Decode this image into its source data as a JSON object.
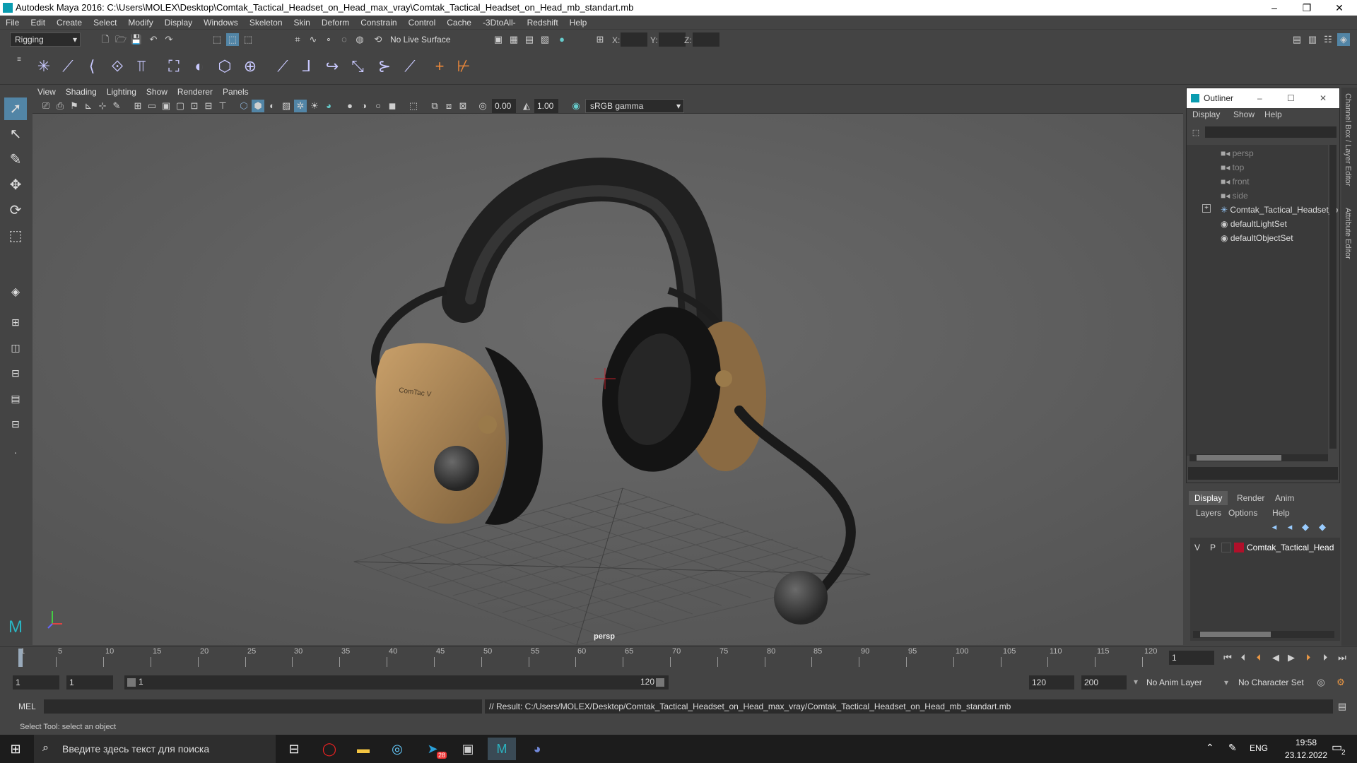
{
  "window": {
    "title": "Autodesk Maya 2016: C:\\Users\\MOLEX\\Desktop\\Comtak_Tactical_Headset_on_Head_max_vray\\Comtak_Tactical_Headset_on_Head_mb_standart.mb",
    "minimize": "–",
    "restore": "❐",
    "close": "✕"
  },
  "menubar": [
    "File",
    "Edit",
    "Create",
    "Select",
    "Modify",
    "Display",
    "Windows",
    "Skeleton",
    "Skin",
    "Deform",
    "Constrain",
    "Control",
    "Cache",
    "-3DtoAll-",
    "Redshift",
    "Help"
  ],
  "statusline": {
    "mode": "Rigging",
    "live_surface": "No Live Surface",
    "x_label": "X:",
    "y_label": "Y:",
    "z_label": "Z:"
  },
  "panel_menu": [
    "View",
    "Shading",
    "Lighting",
    "Show",
    "Renderer",
    "Panels"
  ],
  "panel_toolbar": {
    "value1": "0.00",
    "value2": "1.00",
    "color_space": "sRGB gamma"
  },
  "viewport": {
    "camera_label": "persp",
    "ear_logo": "ComTac V"
  },
  "outliner": {
    "title": "Outliner",
    "menu": [
      "Display",
      "Show",
      "Help"
    ],
    "items": [
      {
        "label": "persp",
        "dim": true
      },
      {
        "label": "top",
        "dim": true
      },
      {
        "label": "front",
        "dim": true
      },
      {
        "label": "side",
        "dim": true
      },
      {
        "label": "Comtak_Tactical_Headset_o",
        "dim": false
      },
      {
        "label": "defaultLightSet",
        "dim": false
      },
      {
        "label": "defaultObjectSet",
        "dim": false
      }
    ]
  },
  "layer_editor": {
    "tabs": [
      "Display",
      "Render",
      "Anim"
    ],
    "menu": [
      "Layers",
      "Options",
      "Help"
    ],
    "layer": {
      "v": "V",
      "p": "P",
      "name": "Comtak_Tactical_Head",
      "color": "#b0102a"
    }
  },
  "right_strip": {
    "label1": "Channel Box / Layer Editor",
    "label2": "Attribute Editor"
  },
  "timeline": {
    "ticks": [
      "1",
      "5",
      "10",
      "15",
      "20",
      "25",
      "30",
      "35",
      "40",
      "45",
      "50",
      "55",
      "60",
      "65",
      "70",
      "75",
      "80",
      "85",
      "90",
      "95",
      "100",
      "105",
      "110",
      "115",
      "120"
    ],
    "current_frame": "1"
  },
  "range": {
    "start": "1",
    "playback_start": "1",
    "slider_start": "1",
    "slider_end": "120",
    "playback_end": "120",
    "end": "200",
    "anim_layer": "No Anim Layer",
    "character_set": "No Character Set"
  },
  "command": {
    "lang": "MEL",
    "result": "// Result: C:/Users/MOLEX/Desktop/Comtak_Tactical_Headset_on_Head_max_vray/Comtak_Tactical_Headset_on_Head_mb_standart.mb"
  },
  "helpline": "Select Tool: select an object",
  "taskbar": {
    "search_placeholder": "Введите здесь текст для поиска",
    "lang": "ENG",
    "time": "19:58",
    "date": "23.12.2022",
    "notif_count": "2",
    "telegram_badge": "28"
  }
}
